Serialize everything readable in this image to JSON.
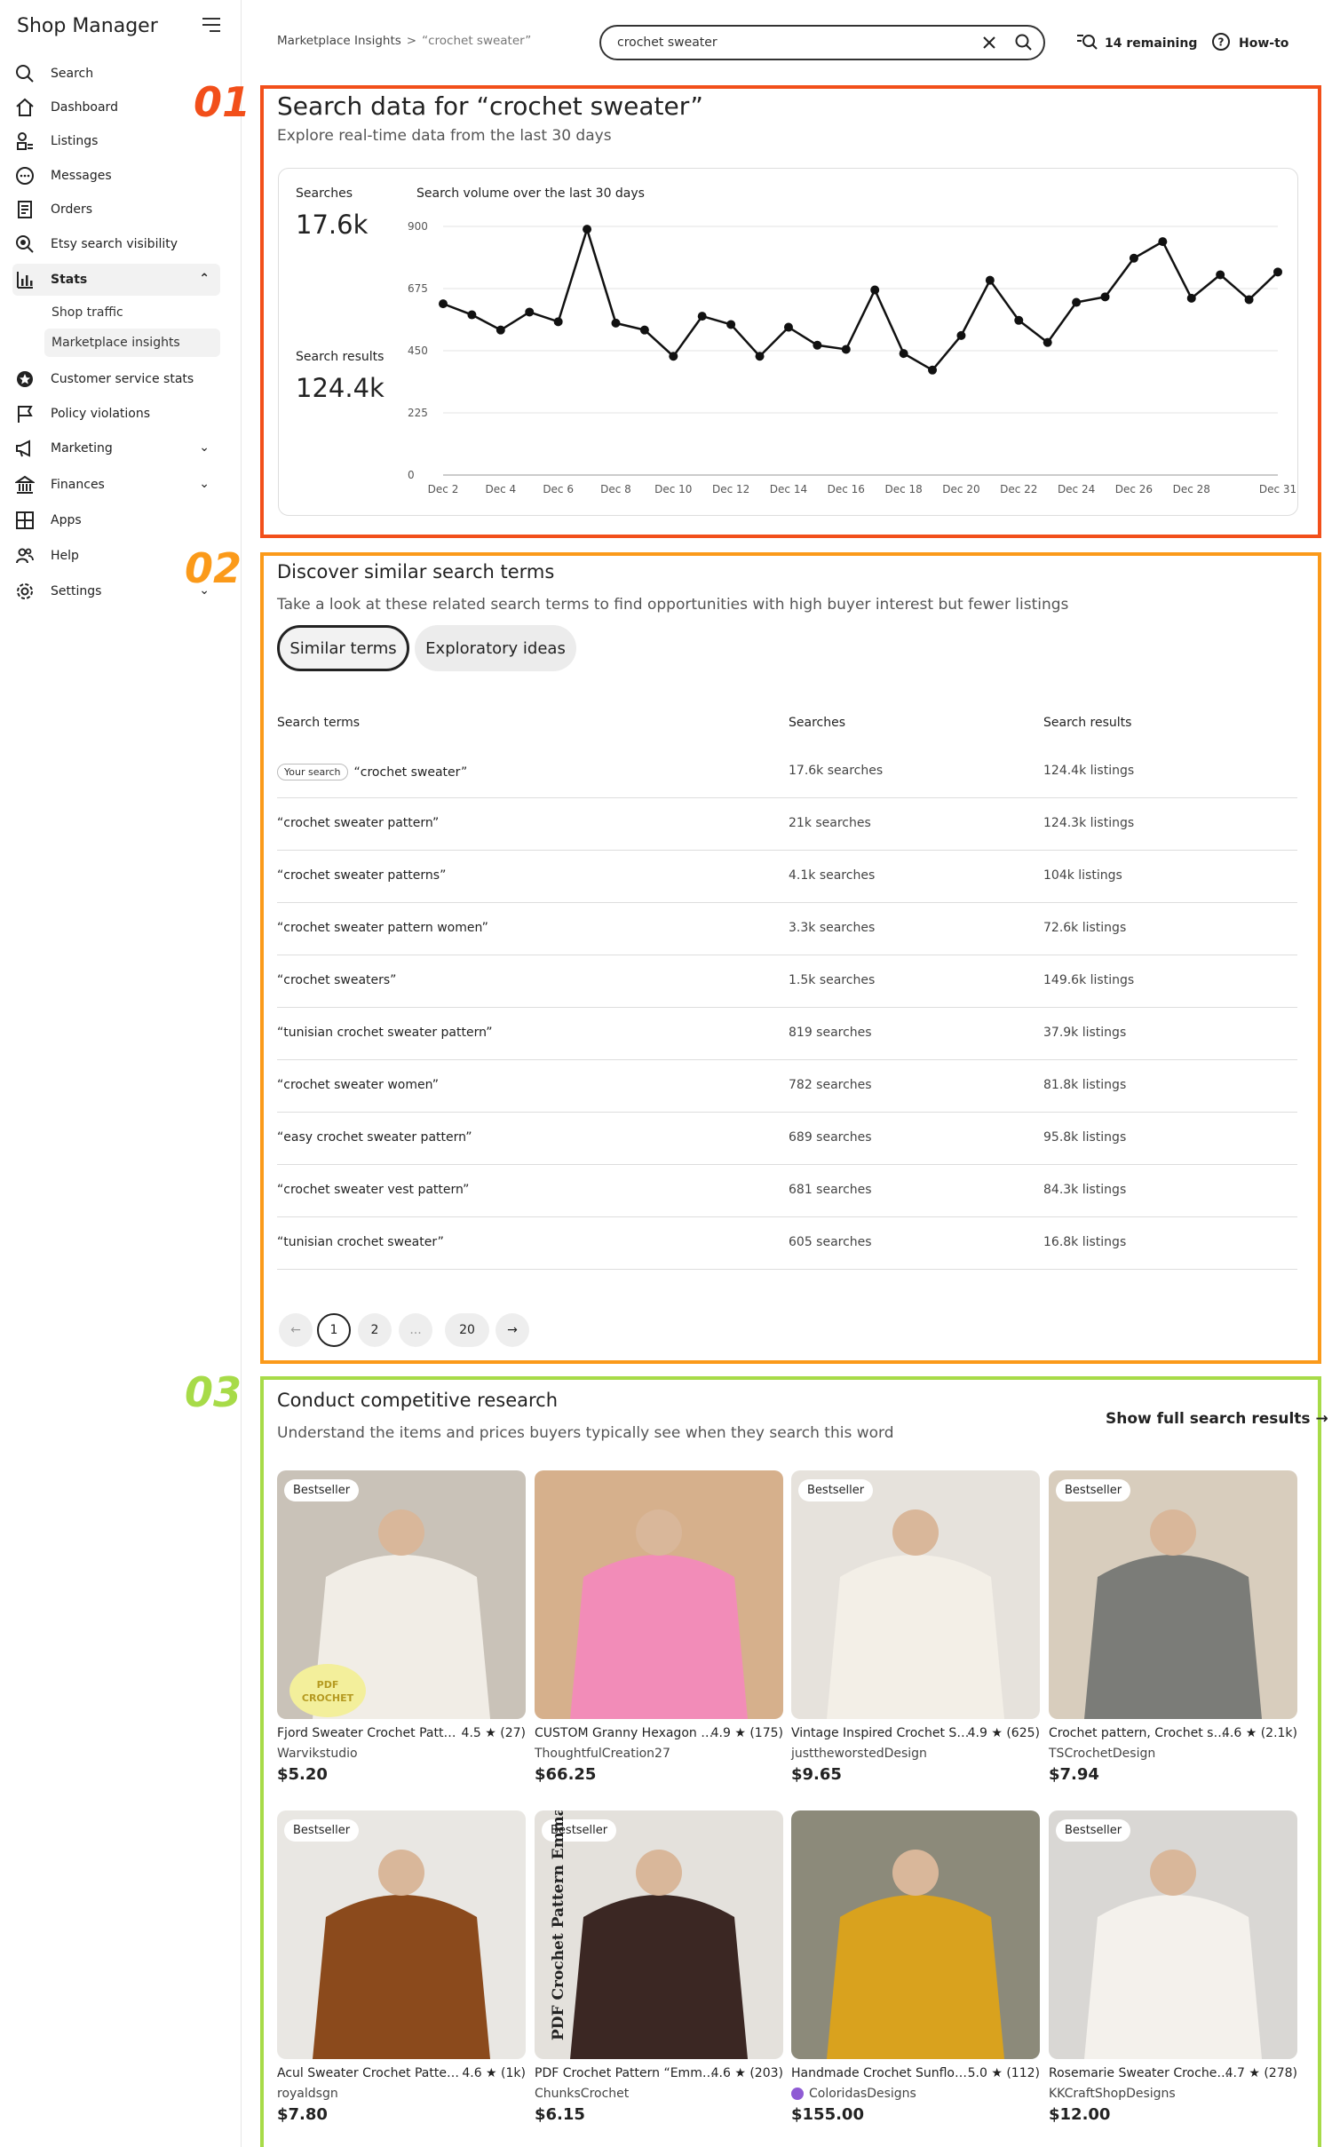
{
  "sidebar": {
    "brand": "Shop Manager",
    "items": [
      {
        "label": "Search"
      },
      {
        "label": "Dashboard"
      },
      {
        "label": "Listings"
      },
      {
        "label": "Messages"
      },
      {
        "label": "Orders"
      },
      {
        "label": "Etsy search visibility"
      },
      {
        "label": "Stats"
      },
      {
        "label": "Customer service stats"
      },
      {
        "label": "Policy violations"
      },
      {
        "label": "Marketing"
      },
      {
        "label": "Finances"
      },
      {
        "label": "Apps"
      },
      {
        "label": "Help"
      },
      {
        "label": "Settings"
      }
    ],
    "stats_sub": [
      {
        "label": "Shop traffic"
      },
      {
        "label": "Marketplace insights"
      }
    ]
  },
  "topbar": {
    "breadcrumb_root": "Marketplace Insights",
    "breadcrumb_sep": ">",
    "breadcrumb_current": "“crochet sweater”",
    "search_value": "crochet sweater",
    "remaining": "14 remaining",
    "howto": "How-to"
  },
  "annotations": {
    "n1": "01",
    "n2": "02",
    "n3": "03",
    "c1": "#f24f1a",
    "c2": "#fb9a1a",
    "c3": "#a7db48"
  },
  "section1": {
    "title": "Search data for “crochet sweater”",
    "subtitle": "Explore real-time data from the last 30 days",
    "searches_label": "Searches",
    "searches_value": "17.6k",
    "results_label": "Search results",
    "results_value": "124.4k"
  },
  "chart_data": {
    "type": "line",
    "title": "Search volume over the last 30 days",
    "ylim": [
      0,
      900
    ],
    "yticks": [
      0,
      225,
      450,
      675,
      900
    ],
    "xtick_labels": [
      "Dec 2",
      "Dec 4",
      "Dec 6",
      "Dec 8",
      "Dec 10",
      "Dec 12",
      "Dec 14",
      "Dec 16",
      "Dec 18",
      "Dec 20",
      "Dec 22",
      "Dec 24",
      "Dec 26",
      "Dec 28",
      "Dec 31"
    ],
    "x": [
      "Dec 2",
      "Dec 3",
      "Dec 4",
      "Dec 5",
      "Dec 6",
      "Dec 7",
      "Dec 8",
      "Dec 9",
      "Dec 10",
      "Dec 11",
      "Dec 12",
      "Dec 13",
      "Dec 14",
      "Dec 15",
      "Dec 16",
      "Dec 17",
      "Dec 18",
      "Dec 19",
      "Dec 20",
      "Dec 21",
      "Dec 22",
      "Dec 23",
      "Dec 24",
      "Dec 25",
      "Dec 26",
      "Dec 27",
      "Dec 28",
      "Dec 29",
      "Dec 30",
      "Dec 31"
    ],
    "values": [
      620,
      580,
      525,
      590,
      555,
      890,
      550,
      525,
      430,
      575,
      545,
      430,
      535,
      470,
      455,
      670,
      440,
      380,
      505,
      705,
      560,
      480,
      625,
      645,
      785,
      845,
      640,
      725,
      635,
      735
    ]
  },
  "section2": {
    "title": "Discover similar search terms",
    "subtitle": "Take a look at these related search terms to find opportunities with high buyer interest but fewer listings",
    "tab_similar": "Similar terms",
    "tab_exploratory": "Exploratory ideas",
    "col_terms": "Search terms",
    "col_searches": "Searches",
    "col_results": "Search results",
    "your_search": "Your search",
    "rows": [
      {
        "term": "“crochet sweater”",
        "searches": "17.6k searches",
        "results": "124.4k listings"
      },
      {
        "term": "“crochet sweater pattern”",
        "searches": "21k searches",
        "results": "124.3k listings"
      },
      {
        "term": "“crochet sweater patterns”",
        "searches": "4.1k searches",
        "results": "104k listings"
      },
      {
        "term": "“crochet sweater pattern women”",
        "searches": "3.3k searches",
        "results": "72.6k listings"
      },
      {
        "term": "“crochet sweaters”",
        "searches": "1.5k searches",
        "results": "149.6k listings"
      },
      {
        "term": "“tunisian crochet sweater pattern”",
        "searches": "819 searches",
        "results": "37.9k listings"
      },
      {
        "term": "“crochet sweater women”",
        "searches": "782 searches",
        "results": "81.8k listings"
      },
      {
        "term": "“easy crochet sweater pattern”",
        "searches": "689 searches",
        "results": "95.8k listings"
      },
      {
        "term": "“crochet sweater vest pattern”",
        "searches": "681 searches",
        "results": "84.3k listings"
      },
      {
        "term": "“tunisian crochet sweater”",
        "searches": "605 searches",
        "results": "16.8k listings"
      }
    ],
    "pages": [
      "←",
      "1",
      "2",
      "...",
      "20",
      "→"
    ]
  },
  "section3": {
    "title": "Conduct competitive research",
    "subtitle": "Understand the items and prices buyers typically see when they search this word",
    "show_full": "Show full search results →",
    "products": [
      {
        "badge": "Bestseller",
        "title": "Fjord Sweater Crochet Pattern",
        "rating": "4.5 ★ (27)",
        "shop": "Warvikstudio",
        "price": "$5.20",
        "sticker": "PDF CROCHET",
        "bg": "#c9c2b8",
        "fg": "#f1ede6"
      },
      {
        "badge": "",
        "title": "CUSTOM Granny Hexagon Cardigan",
        "rating": "4.9 ★ (175)",
        "shop": "ThoughtfulCreation27",
        "price": "$66.25",
        "bg": "#d6b08c",
        "fg": "#f28cb8"
      },
      {
        "badge": "Bestseller",
        "title": "Vintage Inspired Crochet Sweater",
        "rating": "4.9 ★ (625)",
        "shop": "justtheworstedDesign",
        "price": "$9.65",
        "bg": "#e6e2dc",
        "fg": "#f3efe7"
      },
      {
        "badge": "Bestseller",
        "title": "Crochet pattern, Crochet sweater",
        "rating": "4.6 ★ (2.1k)",
        "shop": "TSCrochetDesign",
        "price": "$7.94",
        "bg": "#d8cdbd",
        "fg": "#7b7c78"
      },
      {
        "badge": "Bestseller",
        "title": "Acul Sweater Crochet Pattern",
        "rating": "4.6 ★ (1k)",
        "shop": "royaldsgn",
        "price": "$7.80",
        "bg": "#e9e7e3",
        "fg": "#8b4a1c"
      },
      {
        "badge": "Bestseller",
        "title": "PDF Crochet Pattern “Emma Sweater”",
        "rating": "4.6 ★ (203)",
        "shop": "ChunksCrochet",
        "price": "$6.15",
        "sideText": "PDF Crochet Pattern Emma Sweater",
        "bg": "#e4e1dc",
        "fg": "#3b2723"
      },
      {
        "badge": "",
        "title": "Handmade Crochet Sunflower Cardigan",
        "rating": "5.0 ★ (112)",
        "shop": "ColoridasDesigns",
        "price": "$155.00",
        "bg": "#8c8a7a",
        "fg": "#d9a21e"
      },
      {
        "badge": "Bestseller",
        "title": "Rosemarie Sweater Crochet Pattern",
        "rating": "4.7 ★ (278)",
        "shop": "KKCraftShopDesigns",
        "price": "$12.00",
        "bg": "#d9d7d4",
        "fg": "#f4f1ec"
      }
    ]
  }
}
